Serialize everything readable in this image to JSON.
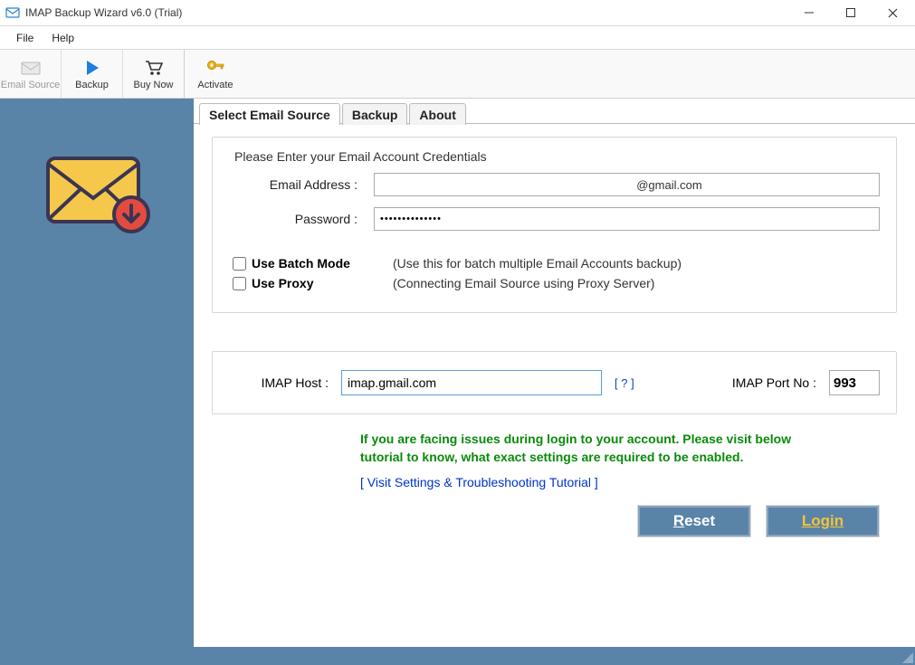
{
  "window": {
    "title": "IMAP Backup Wizard v6.0 (Trial)"
  },
  "menu": {
    "file": "File",
    "help": "Help"
  },
  "toolbar": {
    "email_source": "Email Source",
    "backup": "Backup",
    "buy_now": "Buy Now",
    "activate": "Activate"
  },
  "tabs": {
    "select": "Select Email Source",
    "backup": "Backup",
    "about": "About"
  },
  "credentials": {
    "legend": "Please Enter your Email Account Credentials",
    "email_label": "Email Address :",
    "email_value": "                          @gmail.com",
    "password_label": "Password :",
    "password_value": "••••••••••••••",
    "batch_label": "Use Batch Mode",
    "batch_desc": "(Use this for batch multiple Email Accounts backup)",
    "proxy_label": "Use Proxy",
    "proxy_desc": "(Connecting Email Source using Proxy Server)"
  },
  "imap": {
    "host_label": "IMAP Host :",
    "host_value": "imap.gmail.com",
    "help_link": "[ ? ]",
    "port_label": "IMAP Port No :",
    "port_value": "993"
  },
  "info": {
    "text": "If you are facing issues during login to your account. Please visit below tutorial to know, what exact settings are required to be enabled.",
    "tutorial": "[ Visit Settings & Troubleshooting Tutorial ]"
  },
  "buttons": {
    "reset_prefix": "R",
    "reset_rest": "eset",
    "login": "Login"
  }
}
